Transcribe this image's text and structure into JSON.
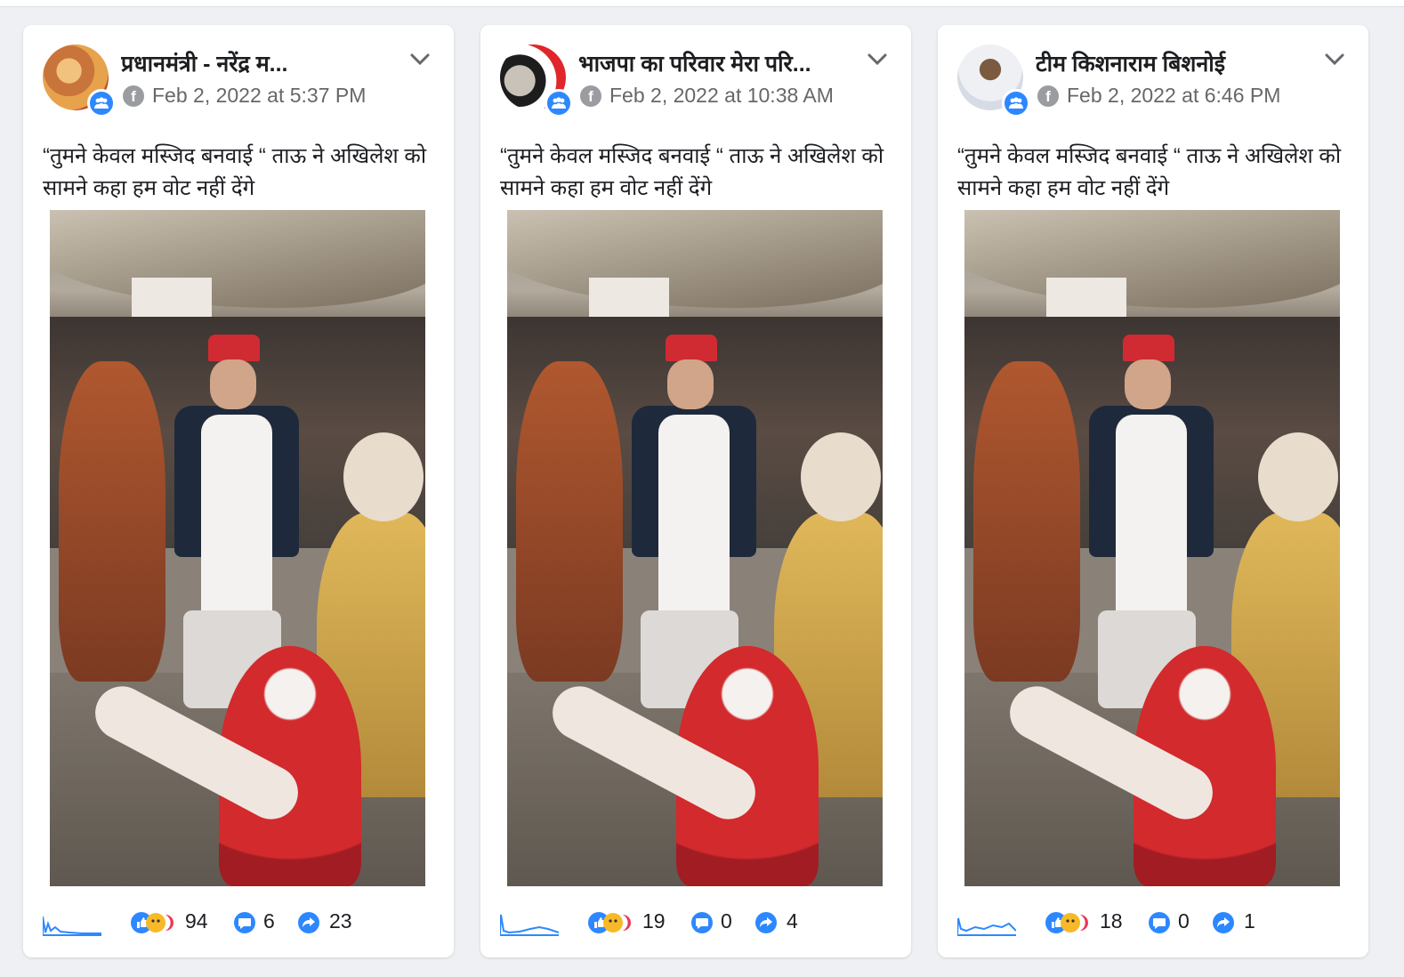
{
  "colors": {
    "facebook_blue": "#2d88ff",
    "text_primary": "#1c1e21",
    "text_secondary": "#65676b",
    "card_bg": "#ffffff",
    "page_bg": "#eef0f3"
  },
  "icons": {
    "group": "group-icon",
    "facebook": "facebook-icon",
    "menu": "chevron-down-icon",
    "reactions": "reactions-icon",
    "comments": "comment-icon",
    "shares": "share-icon",
    "trend": "sparkline-icon"
  },
  "posts": [
    {
      "page_name": "प्रधानमंत्री - नरेंद्र म...",
      "timestamp": "Feb 2, 2022 at 5:37 PM",
      "text": "“तुमने केवल मस्जिद बनवाई “ ताऊ ने अखिलेश को सामने कहा हम वोट नहीं देंगे",
      "reactions": "94",
      "comments": "6",
      "shares": "23"
    },
    {
      "page_name": "भाजपा का परिवार मेरा परि...",
      "timestamp": "Feb 2, 2022 at 10:38 AM",
      "text": "“तुमने केवल मस्जिद बनवाई “ ताऊ ने अखिलेश को सामने कहा हम वोट नहीं देंगे",
      "reactions": "19",
      "comments": "0",
      "shares": "4"
    },
    {
      "page_name": "टीम किशनाराम बिशनोई",
      "timestamp": "Feb 2, 2022 at 6:46 PM",
      "text": "“तुमने केवल मस्जिद बनवाई “ ताऊ ने अखिलेश को सामने कहा हम वोट नहीं देंगे",
      "reactions": "18",
      "comments": "0",
      "shares": "1"
    }
  ]
}
